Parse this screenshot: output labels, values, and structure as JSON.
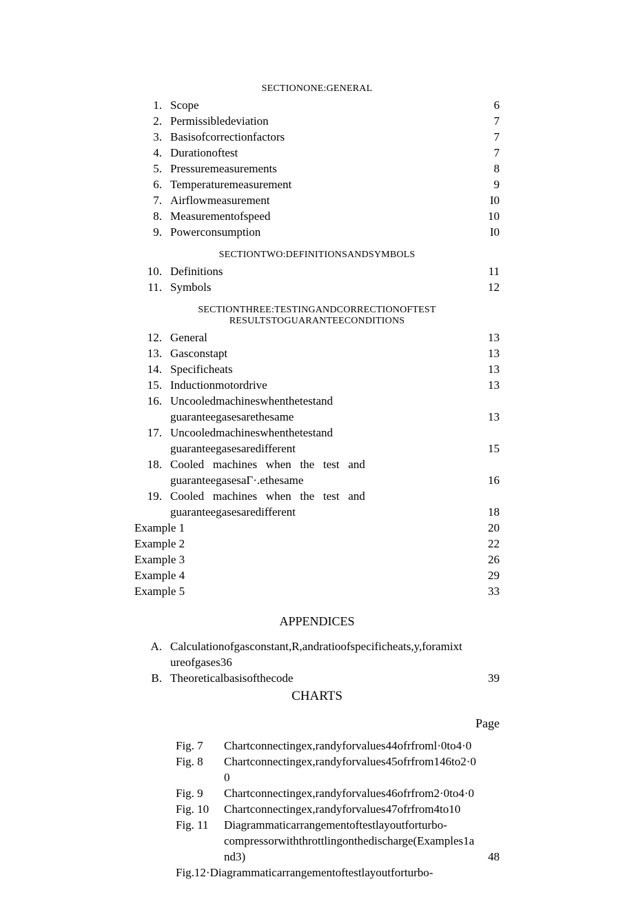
{
  "section1_heading": "SECTIONONE:GENERAL",
  "section1": [
    {
      "n": "1.",
      "t": "Scope",
      "p": "6"
    },
    {
      "n": "2.",
      "t": "Permissibledeviation",
      "p": "7"
    },
    {
      "n": "3.",
      "t": "Basisofcorrectionfactors",
      "p": "7"
    },
    {
      "n": "4.",
      "t": "Durationoftest",
      "p": "7"
    },
    {
      "n": "5.",
      "t": "Pressuremeasurements",
      "p": "8"
    },
    {
      "n": "6.",
      "t": "Temperaturemeasurement",
      "p": "9"
    },
    {
      "n": "7.",
      "t": "Airflowmeasurement",
      "p": "I0"
    },
    {
      "n": "8.",
      "t": "Measurementofspeed",
      "p": "10"
    },
    {
      "n": "9.",
      "t": "Powerconsumption",
      "p": "I0"
    }
  ],
  "section2_heading": "SECTIONTWO:DEFINITIONSANDSYMBOLS",
  "section2": [
    {
      "n": "10.",
      "t": "Definitions",
      "p": "11"
    },
    {
      "n": "11.",
      "t": "Symbols",
      "p": "12"
    }
  ],
  "section3_heading_l1": "SECTIONTHREE:TESTINGANDCORRECTIONOFTEST",
  "section3_heading_l2": "RESULTSTOGUARANTEECONDITIONS",
  "section3a": [
    {
      "n": "12.",
      "t": "General",
      "p": "13"
    },
    {
      "n": "13.",
      "t": "Gasconstapt",
      "p": "13"
    },
    {
      "n": "14.",
      "t": "Specificheats",
      "p": "13"
    },
    {
      "n": "15.",
      "t": "Inductionmotordrive",
      "p": "13"
    }
  ],
  "s3_16_n": "16.",
  "s3_16_l1": "Uncooledmachineswhenthetestand",
  "s3_16_l2": "guaranteegasesarethesame",
  "s3_16_p": "13",
  "s3_17_n": "17.",
  "s3_17_l1": "Uncooledmachineswhenthetestand",
  "s3_17_l2": "guaranteegasesaredifferent",
  "s3_17_p": "15",
  "s3_18_n": "18.",
  "s3_18_l1": "Cooled   machines   when   the   test   and",
  "s3_18_l2": "guaranteegasesaГ·.ethesame",
  "s3_18_p": "16",
  "s3_19_n": "19.",
  "s3_19_l1": "Cooled   machines   when   the   test   and",
  "s3_19_l2": "guaranteegasesaredifferent",
  "s3_19_p": "18",
  "examples": [
    {
      "t": "Example 1",
      "p": "20"
    },
    {
      "t": "Example 2",
      "p": "22"
    },
    {
      "t": "Example 3",
      "p": "26"
    },
    {
      "t": "Example 4",
      "p": "29"
    },
    {
      "t": "Example 5",
      "p": "33"
    }
  ],
  "appendices_heading": "APPENDICES",
  "app_A_n": "A.",
  "app_A_t": "Calculationofgasconstant,R,andratioofspecificheats,y,foramixtureofgases36",
  "app_B_n": "B.",
  "app_B_t": "Theoreticalbasisofthecode",
  "app_B_p": "39",
  "charts_heading": "CHARTS",
  "page_label": "Page",
  "figs": [
    {
      "n": "Fig. 7",
      "t": "Chartconnectingex,randyforvalues44ofrfroml·0to4·0",
      "p": ""
    },
    {
      "n": "Fig. 8",
      "t": "Chartconnectingex,randyforvalues45ofrfrom146to2·00",
      "p": ""
    },
    {
      "n": "Fig. 9",
      "t": "Chartconnectingex,randyforvalues46ofrfrom2·0to4·0",
      "p": ""
    },
    {
      "n": "Fig. 10",
      "t": "Chartconnectingex,randyforvalues47ofrfrom4to10",
      "p": ""
    }
  ],
  "fig11_n": "Fig. 11",
  "fig11_l1": "Diagrammaticarrangementoftestlayoutforturbo-",
  "fig11_l2": "compressorwiththrottlingonthedischarge(Examples1and3)",
  "fig11_p": "48",
  "fig12": "Fig.12·Diagrammaticarrangementoftestlayoutforturbo-"
}
